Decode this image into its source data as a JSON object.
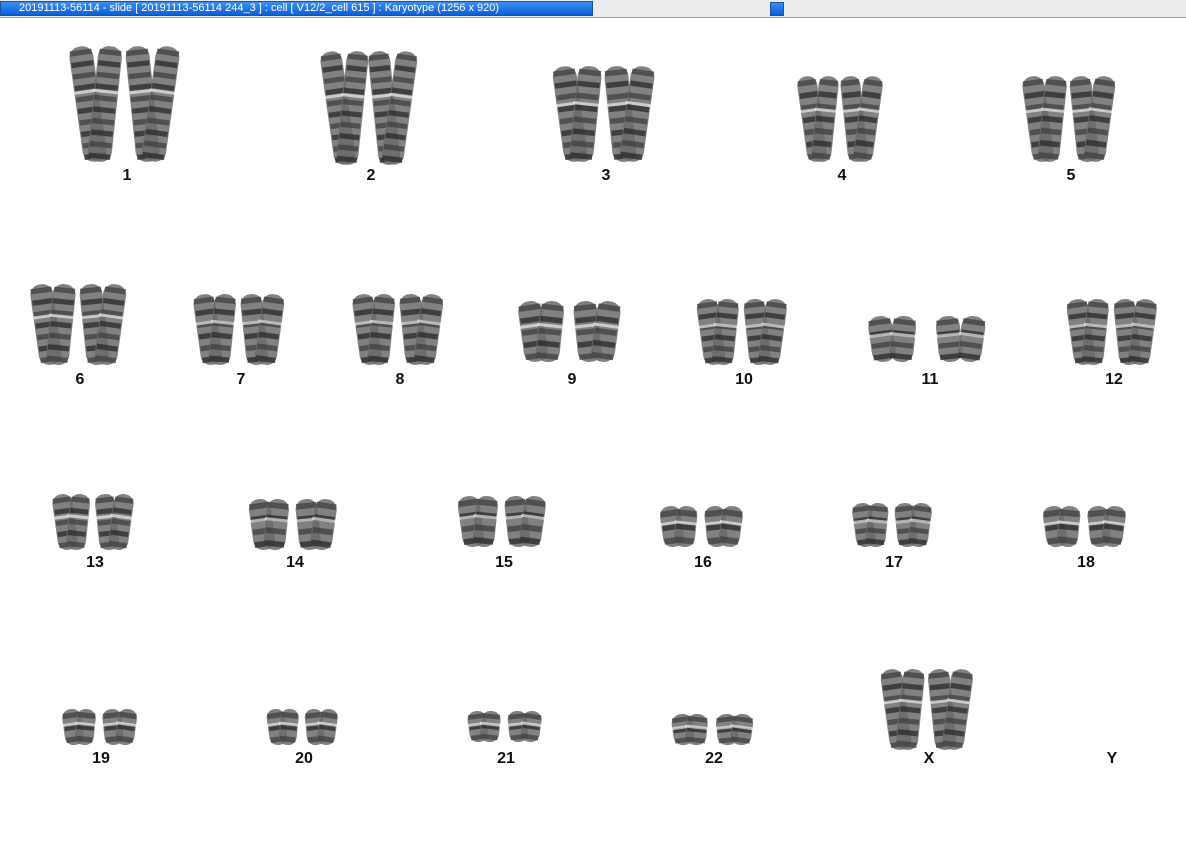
{
  "window": {
    "title": "20191113-56114 - slide [ 20191113-56114 244_3 ] : cell [ V12/2_cell 615 ] : Karyotype  (1256 x 920)"
  },
  "karyotype": {
    "chromosomes": [
      {
        "label": "1"
      },
      {
        "label": "2"
      },
      {
        "label": "3"
      },
      {
        "label": "4"
      },
      {
        "label": "5"
      },
      {
        "label": "6"
      },
      {
        "label": "7"
      },
      {
        "label": "8"
      },
      {
        "label": "9"
      },
      {
        "label": "10"
      },
      {
        "label": "11"
      },
      {
        "label": "12"
      },
      {
        "label": "13"
      },
      {
        "label": "14"
      },
      {
        "label": "15"
      },
      {
        "label": "16"
      },
      {
        "label": "17"
      },
      {
        "label": "18"
      },
      {
        "label": "19"
      },
      {
        "label": "20"
      },
      {
        "label": "21"
      },
      {
        "label": "22"
      },
      {
        "label": "X"
      },
      {
        "label": "Y"
      }
    ]
  }
}
